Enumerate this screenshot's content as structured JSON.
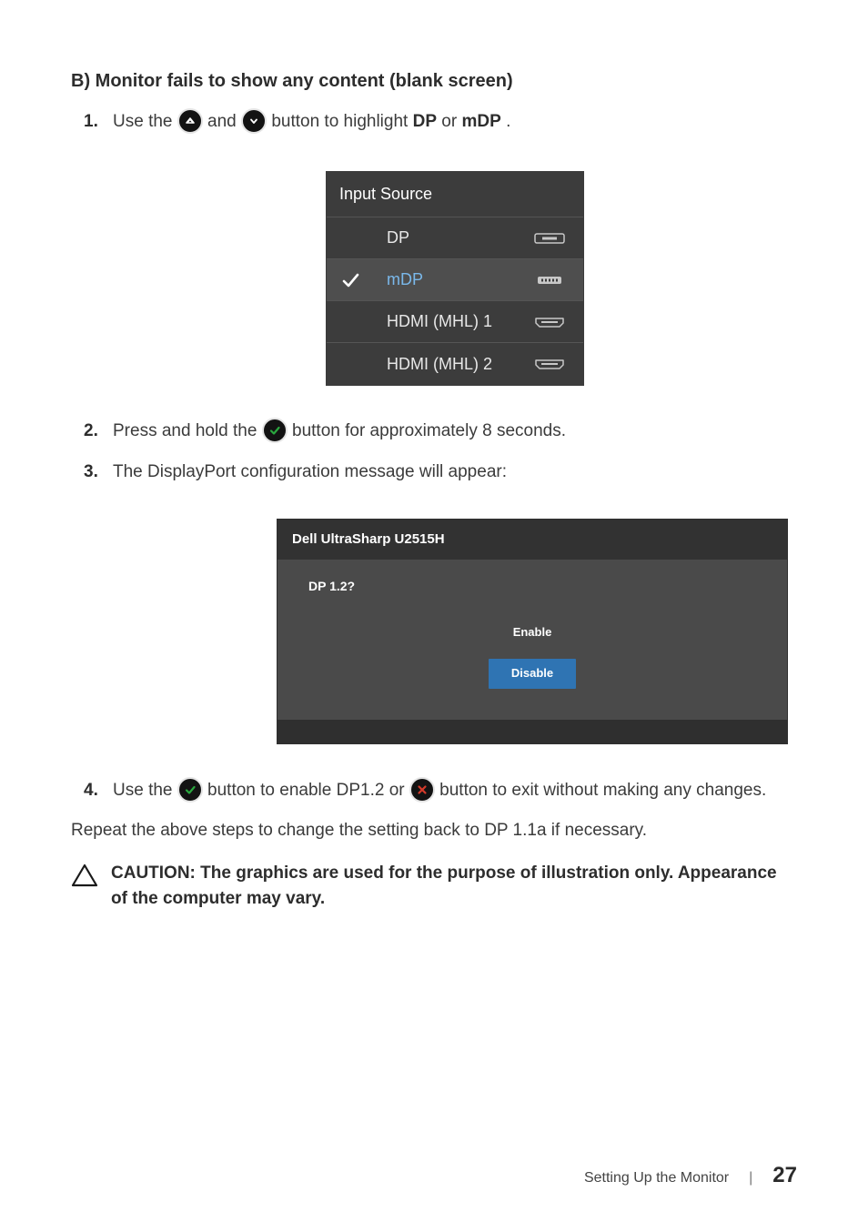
{
  "section_title": "B) Monitor fails to show any content (blank screen)",
  "steps": {
    "s1": {
      "num": "1.",
      "t1": "Use the ",
      "t2": " and ",
      "t3": " button to highlight ",
      "dp": "DP",
      "t4": " or ",
      "mdp": "mDP",
      "t5": "."
    },
    "s2": {
      "num": "2.",
      "t1": "Press and hold the ",
      "t2": " button for approximately 8 seconds."
    },
    "s3": {
      "num": "3.",
      "t1": "The DisplayPort configuration message will appear:"
    },
    "s4": {
      "num": "4.",
      "t1": "Use the ",
      "t2": " button to enable DP1.2 or ",
      "t3": " button to exit without making any changes."
    }
  },
  "input_source_panel": {
    "title": "Input Source",
    "rows": [
      {
        "label": "DP",
        "selected": false
      },
      {
        "label": "mDP",
        "selected": true
      },
      {
        "label": "HDMI (MHL) 1",
        "selected": false
      },
      {
        "label": "HDMI (MHL) 2",
        "selected": false
      }
    ]
  },
  "dp_dialog": {
    "model": "Dell UltraSharp U2515H",
    "question": "DP 1.2?",
    "enable": "Enable",
    "disable": "Disable"
  },
  "repeat_text": "Repeat the above steps to change the setting back to DP 1.1a if necessary.",
  "caution_text": "CAUTION: The graphics are used for the purpose of illustration only. Appearance of the computer may vary.",
  "footer": {
    "section": "Setting Up the Monitor",
    "divider": "|",
    "page": "27"
  }
}
